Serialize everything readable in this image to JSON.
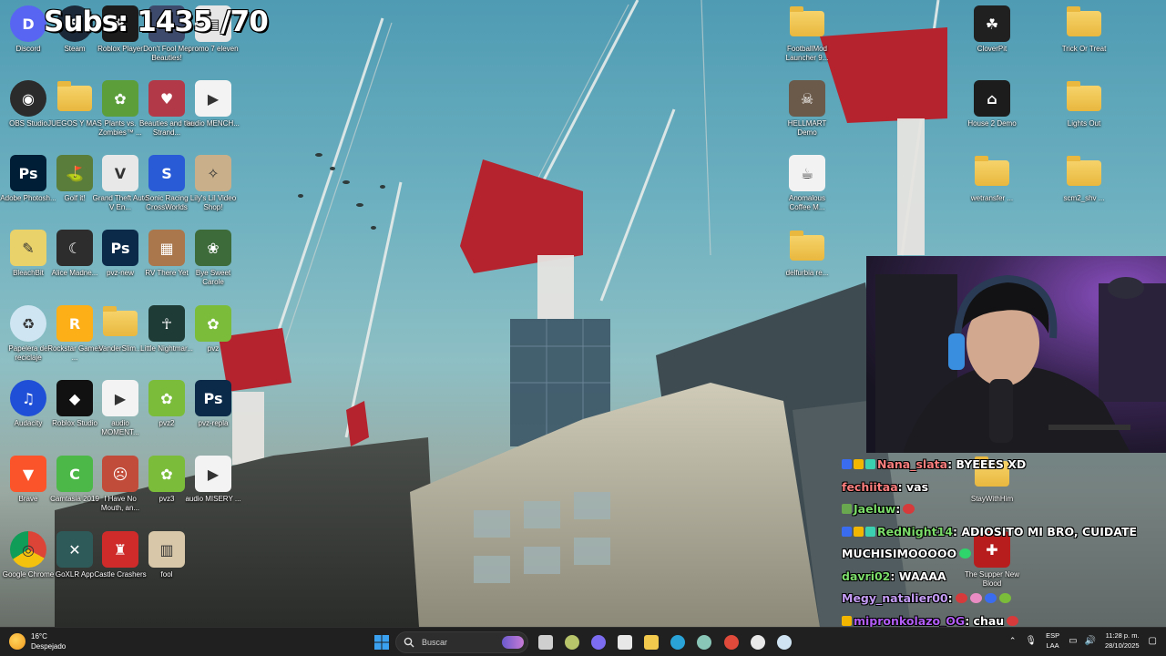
{
  "overlay": {
    "subs_text": "Subs: 1435 /70"
  },
  "desktop_left": [
    {
      "label": "Discord",
      "icon": "discord-icon",
      "color": "#5865f2",
      "glyph": "D"
    },
    {
      "label": "Steam",
      "icon": "steam-icon",
      "color": "#1b2838",
      "glyph": "S"
    },
    {
      "label": "Roblox Player",
      "icon": "roblox-icon",
      "color": "#1c1c1c",
      "glyph": "R"
    },
    {
      "label": "Don't Fool Me, Beauties!",
      "icon": "game-icon",
      "color": "#3d4a6b",
      "glyph": "✦"
    },
    {
      "label": "promo 7 eleven",
      "icon": "document-icon",
      "color": "#e6e6e6",
      "glyph": "▤"
    },
    {
      "label": "OBS Studio",
      "icon": "obs-icon",
      "color": "#2b2b2b",
      "glyph": "◉"
    },
    {
      "label": "JUEGOS Y MAS",
      "icon": "folder-icon",
      "color": "#f2c94c",
      "glyph": ""
    },
    {
      "label": "Plants vs. Zombies™ ...",
      "icon": "pvz-icon",
      "color": "#5b9e3a",
      "glyph": "✿"
    },
    {
      "label": "Beauties and the Strand...",
      "icon": "game-icon",
      "color": "#b23a48",
      "glyph": "♥"
    },
    {
      "label": "audio MENCH...",
      "icon": "audio-file-icon",
      "color": "#f3f3f3",
      "glyph": "▶"
    },
    {
      "label": "Adobe Photosh...",
      "icon": "photoshop-icon",
      "color": "#001e36",
      "glyph": "Ps"
    },
    {
      "label": "Golf it!",
      "icon": "golf-icon",
      "color": "#5a7d3b",
      "glyph": "⛳"
    },
    {
      "label": "Grand Theft Auto V En...",
      "icon": "gta-icon",
      "color": "#e8e8e8",
      "glyph": "V"
    },
    {
      "label": "Sonic Racing CrossWorlds",
      "icon": "sonic-icon",
      "color": "#2a5bd7",
      "glyph": "S"
    },
    {
      "label": "Lily's Lil Video Shop!",
      "icon": "game-icon",
      "color": "#c9b08a",
      "glyph": "✧"
    },
    {
      "label": "BleachBit",
      "icon": "bleachbit-icon",
      "color": "#e9d26a",
      "glyph": "✎"
    },
    {
      "label": "Alice Madne...",
      "icon": "alice-icon",
      "color": "#2d2d2d",
      "glyph": "☾"
    },
    {
      "label": "pvz-new",
      "icon": "psd-file-icon",
      "color": "#0b2a4a",
      "glyph": "Ps"
    },
    {
      "label": "RV There Yet",
      "icon": "game-icon",
      "color": "#a9774b",
      "glyph": "▦"
    },
    {
      "label": "Bye Sweet Carole",
      "icon": "game-icon",
      "color": "#3e6b3a",
      "glyph": "❀"
    },
    {
      "label": "Papelera de reciclaje",
      "icon": "recycle-bin-icon",
      "color": "#cfe6f2",
      "glyph": "♻"
    },
    {
      "label": "Rockstar Games ...",
      "icon": "rockstar-icon",
      "color": "#fcaf17",
      "glyph": "R"
    },
    {
      "label": "VanderSlim...",
      "icon": "folder-icon",
      "color": "#f2c94c",
      "glyph": ""
    },
    {
      "label": "Little Nightmar...",
      "icon": "game-icon",
      "color": "#1f3b36",
      "glyph": "☥"
    },
    {
      "label": "pvz",
      "icon": "pvz-icon",
      "color": "#7bbd3a",
      "glyph": "✿"
    },
    {
      "label": "Audacity",
      "icon": "audacity-icon",
      "color": "#1f4fd6",
      "glyph": "♫"
    },
    {
      "label": "Roblox Studio",
      "icon": "roblox-studio-icon",
      "color": "#111111",
      "glyph": "◆"
    },
    {
      "label": "audio MOMENT...",
      "icon": "audio-file-icon",
      "color": "#f3f3f3",
      "glyph": "▶"
    },
    {
      "label": "pvz2",
      "icon": "pvz-icon",
      "color": "#7bbd3a",
      "glyph": "✿"
    },
    {
      "label": "pvz-repla",
      "icon": "psd-file-icon",
      "color": "#0b2a4a",
      "glyph": "Ps"
    },
    {
      "label": "Brave",
      "icon": "brave-icon",
      "color": "#fb542b",
      "glyph": "▼"
    },
    {
      "label": "Camtasia 2019",
      "icon": "camtasia-icon",
      "color": "#4cb848",
      "glyph": "C"
    },
    {
      "label": "I Have No Mouth, an...",
      "icon": "game-icon",
      "color": "#c24c3a",
      "glyph": "☹"
    },
    {
      "label": "pvz3",
      "icon": "pvz-icon",
      "color": "#7bbd3a",
      "glyph": "✿"
    },
    {
      "label": "audio MISERY ...",
      "icon": "audio-file-icon",
      "color": "#f3f3f3",
      "glyph": "▶"
    },
    {
      "label": "Google Chrome",
      "icon": "chrome-icon",
      "color": "#e8e8e8",
      "glyph": "◎"
    },
    {
      "label": "GoXLR App",
      "icon": "goxlr-icon",
      "color": "#2f5a5a",
      "glyph": "✕"
    },
    {
      "label": "Castle Crashers",
      "icon": "castle-crashers-icon",
      "color": "#cf2b2b",
      "glyph": "♜"
    },
    {
      "label": "fool",
      "icon": "image-file-icon",
      "color": "#d8c7a8",
      "glyph": "▥"
    }
  ],
  "desktop_right": [
    {
      "label": "FootballMod Launcher 9...",
      "icon": "folder-icon",
      "color": "#f2c94c",
      "glyph": ""
    },
    {
      "label": "CloverPit",
      "icon": "game-icon",
      "color": "#202020",
      "glyph": "☘"
    },
    {
      "label": "Trick Or Treat",
      "icon": "folder-icon",
      "color": "#f2c94c",
      "glyph": ""
    },
    {
      "label": "HELLMART Demo",
      "icon": "game-icon",
      "color": "#6b5a4a",
      "glyph": "☠"
    },
    {
      "label": "House 2 Demo",
      "icon": "game-icon",
      "color": "#1c1c1c",
      "glyph": "⌂"
    },
    {
      "label": "Lights Out",
      "icon": "folder-icon",
      "color": "#f2c94c",
      "glyph": ""
    },
    {
      "label": "Anomalous Coffee M...",
      "icon": "game-icon",
      "color": "#f2f2f2",
      "glyph": "☕"
    },
    {
      "label": "wetransfer ...",
      "icon": "folder-icon",
      "color": "#f2c94c",
      "glyph": ""
    },
    {
      "label": "scm2_shv ...",
      "icon": "folder-icon",
      "color": "#f2c94c",
      "glyph": ""
    },
    {
      "label": "delfurbia re...",
      "icon": "folder-icon",
      "color": "#f2c94c",
      "glyph": ""
    },
    {
      "label": "StayWithHim",
      "icon": "folder-icon",
      "color": "#f2c94c",
      "glyph": ""
    },
    {
      "label": "The Supper New Blood",
      "icon": "game-icon",
      "color": "#b81d1d",
      "glyph": "✚"
    }
  ],
  "chat": [
    {
      "user": "Nana_slata",
      "user_color": "#ff7f7f",
      "text": ": BYEEES XD",
      "badges": [
        "#3a6cf0",
        "#f2b600",
        "#3bd1b0"
      ],
      "emotes": []
    },
    {
      "user": "fechiitaa",
      "user_color": "#ff7f7f",
      "text": ": vas",
      "badges": [],
      "emotes": []
    },
    {
      "user": "Jaeluw",
      "user_color": "#7bdc6a",
      "text": ":",
      "badges": [
        "#6aa84f"
      ],
      "emotes": [
        "#d63a3a"
      ]
    },
    {
      "user": "RedNight14",
      "user_color": "#7bdc6a",
      "text": ": ADIOSITO MI BRO, CUIDATE",
      "badges": [
        "#3a6cf0",
        "#f2b600",
        "#3bd1b0"
      ],
      "emotes": []
    },
    {
      "user": "",
      "user_color": "#ffffff",
      "text": "MUCHISIMOOOOO",
      "badges": [],
      "emotes": [
        "#2fd46a"
      ]
    },
    {
      "user": "davri02",
      "user_color": "#7bdc6a",
      "text": ": WAAAA",
      "badges": [],
      "emotes": []
    },
    {
      "user": "Megy_natalier00",
      "user_color": "#c49cf5",
      "text": ":",
      "badges": [],
      "emotes": [
        "#d63a3a",
        "#e98cc4",
        "#3a6cf0",
        "#7bbd3a"
      ]
    },
    {
      "user": "mipronkolazo_OG",
      "user_color": "#b25cf5",
      "text": ": chau",
      "badges": [
        "#f2b600"
      ],
      "emotes": [
        "#d63a3a"
      ]
    }
  ],
  "taskbar": {
    "weather_temp": "16°C",
    "weather_desc": "Despejado",
    "search_placeholder": "Buscar",
    "apps": [
      {
        "name": "task-view-icon",
        "color": "#cfcfcf"
      },
      {
        "name": "obs-taskbar-icon",
        "color": "#b8c46a"
      },
      {
        "name": "copilot-icon",
        "color": "#7c6cf0"
      },
      {
        "name": "store-icon",
        "color": "#e8e8e8"
      },
      {
        "name": "file-explorer-icon",
        "color": "#f2c94c"
      },
      {
        "name": "edge-icon",
        "color": "#2aa4d8"
      },
      {
        "name": "goxlr-taskbar-icon",
        "color": "#8ac6b8"
      },
      {
        "name": "chrome-taskbar-icon",
        "color": "#e04a3a"
      },
      {
        "name": "discord-taskbar-icon",
        "color": "#e8e8e8"
      },
      {
        "name": "steam-taskbar-icon",
        "color": "#cfe3f2"
      }
    ],
    "lang_top": "ESP",
    "lang_bottom": "LAA",
    "time": "11:28 p. m.",
    "date": "28/10/2025"
  }
}
